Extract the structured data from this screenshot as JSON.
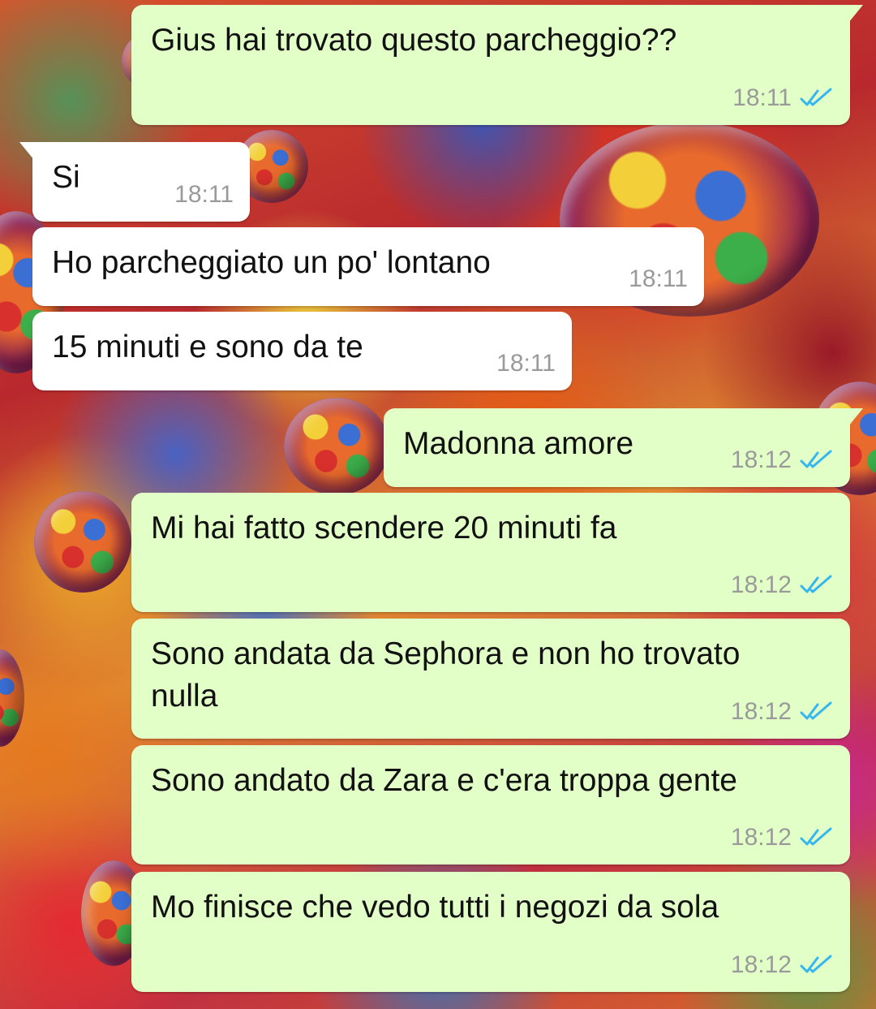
{
  "colors": {
    "outgoing_bubble": "#e2ffc7",
    "incoming_bubble": "#ffffff",
    "timestamp": "#9a9a9a",
    "read_ticks": "#34b7f1"
  },
  "messages": [
    {
      "direction": "outgoing",
      "text": "Gius hai trovato questo parcheggio??",
      "time": "18:11",
      "status": "read",
      "status_icon": "double-check-icon"
    },
    {
      "direction": "incoming",
      "text": "Si",
      "time": "18:11"
    },
    {
      "direction": "incoming",
      "text": "Ho parcheggiato un po' lontano",
      "time": "18:11"
    },
    {
      "direction": "incoming",
      "text": "15 minuti e sono da te",
      "time": "18:11"
    },
    {
      "direction": "outgoing",
      "text": "Madonna amore",
      "time": "18:12",
      "status": "read",
      "status_icon": "double-check-icon"
    },
    {
      "direction": "outgoing",
      "text": "Mi hai fatto scendere 20 minuti fa",
      "time": "18:12",
      "status": "read",
      "status_icon": "double-check-icon"
    },
    {
      "direction": "outgoing",
      "text_lines": [
        "Sono andata da Sephora e non ho trovato",
        "nulla"
      ],
      "time": "18:12",
      "status": "read",
      "status_icon": "double-check-icon"
    },
    {
      "direction": "outgoing",
      "text": "Sono andato da Zara e c'era troppa gente",
      "time": "18:12",
      "status": "read",
      "status_icon": "double-check-icon"
    },
    {
      "direction": "outgoing",
      "text": "Mo finisce che vedo tutti i negozi da sola",
      "time": "18:12",
      "status": "read",
      "status_icon": "double-check-icon"
    }
  ]
}
